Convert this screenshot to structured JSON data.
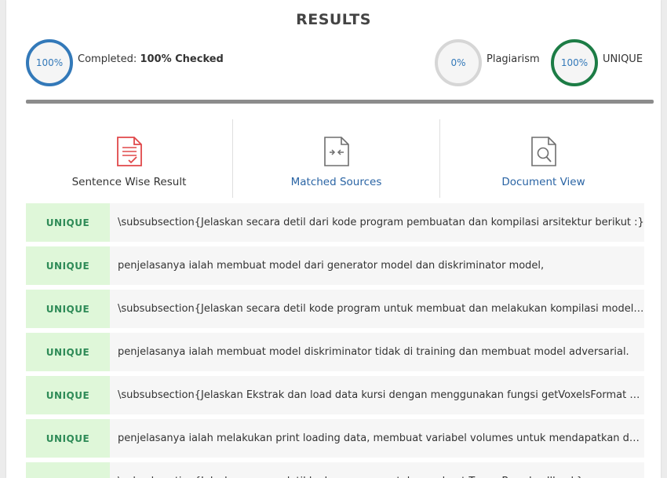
{
  "title": "RESULTS",
  "completed": {
    "percent": "100%",
    "label": "Completed:",
    "value": "100% Checked"
  },
  "plagiarism": {
    "percent": "0%",
    "label": "Plagiarism"
  },
  "unique": {
    "percent": "100%",
    "label": "UNIQUE"
  },
  "tabs": [
    {
      "label": "Sentence Wise Result",
      "icon": "document-check-icon"
    },
    {
      "label": "Matched Sources",
      "icon": "compare-arrows-icon"
    },
    {
      "label": "Document View",
      "icon": "document-search-icon"
    }
  ],
  "rows": [
    {
      "status": "UNIQUE",
      "text": "\\subsubsection{Jelaskan secara detil dari kode program pembuatan dan kompilasi arsitektur berikut :}"
    },
    {
      "status": "UNIQUE",
      "text": "penjelasanya ialah membuat model dari generator model dan diskriminator model,"
    },
    {
      "status": "UNIQUE",
      "text": "\\subsubsection{Jelaskan secara detil kode program untuk membuat dan melakukan kompilasi model adversarial}"
    },
    {
      "status": "UNIQUE",
      "text": "penjelasanya ialah membuat model diskriminator tidak di training dan membuat model adversarial."
    },
    {
      "status": "UNIQUE",
      "text": "\\subsubsection{Jelaskan Ekstrak dan load data kursi dengan menggunakan fungsi getVoxelsFormat dan load data}"
    },
    {
      "status": "UNIQUE",
      "text": "penjelasanya ialah melakukan print loading data, membuat variabel volumes untuk mendapatkan data voxels"
    },
    {
      "status": "UNIQUE",
      "text": "\\subsubsection{Jelaskan secara detil kode program untuk membuat TensorBoard callback}"
    }
  ],
  "colors": {
    "completed_ring": "#3379b9",
    "plagiarism_ring": "#d6d6d6",
    "unique_ring": "#1c7c45",
    "badge_bg": "#dff7d9",
    "badge_text": "#2e8b57",
    "link": "#2a64a4"
  }
}
